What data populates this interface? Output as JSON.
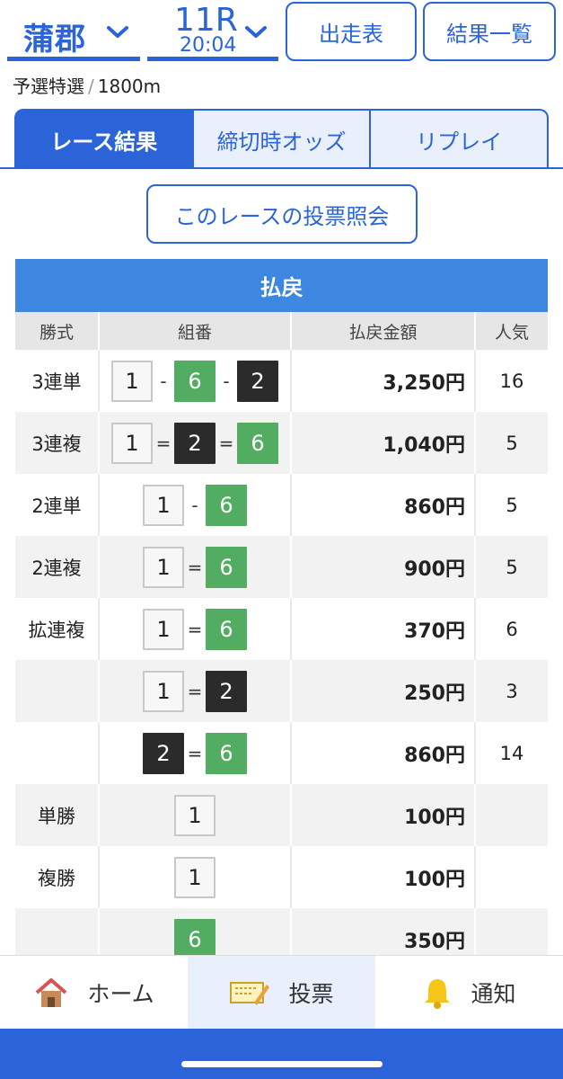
{
  "header": {
    "venue": "蒲郡",
    "race_number": "11R",
    "race_time": "20:04",
    "btn_entry": "出走表",
    "btn_results": "結果一覧"
  },
  "subtitle": {
    "race_type": "予選特選",
    "separator": "/",
    "distance": "1800m"
  },
  "tabs": [
    {
      "label": "レース結果",
      "active": true
    },
    {
      "label": "締切時オッズ",
      "active": false
    },
    {
      "label": "リプレイ",
      "active": false
    }
  ],
  "inquiry_button": "このレースの投票照会",
  "payout": {
    "title": "払戻",
    "headers": [
      "勝式",
      "組番",
      "払戻金額",
      "人気"
    ],
    "rows": [
      {
        "type": "3連単",
        "combo": [
          {
            "n": "1",
            "c": "white"
          },
          {
            "op": "-"
          },
          {
            "n": "6",
            "c": "green"
          },
          {
            "op": "-"
          },
          {
            "n": "2",
            "c": "black"
          }
        ],
        "amount": "3,250円",
        "pop": "16"
      },
      {
        "type": "3連複",
        "combo": [
          {
            "n": "1",
            "c": "white"
          },
          {
            "op": "="
          },
          {
            "n": "2",
            "c": "black"
          },
          {
            "op": "="
          },
          {
            "n": "6",
            "c": "green"
          }
        ],
        "amount": "1,040円",
        "pop": "5"
      },
      {
        "type": "2連単",
        "combo": [
          {
            "n": "1",
            "c": "white"
          },
          {
            "op": "-"
          },
          {
            "n": "6",
            "c": "green"
          }
        ],
        "amount": "860円",
        "pop": "5"
      },
      {
        "type": "2連複",
        "combo": [
          {
            "n": "1",
            "c": "white"
          },
          {
            "op": "="
          },
          {
            "n": "6",
            "c": "green"
          }
        ],
        "amount": "900円",
        "pop": "5"
      },
      {
        "type": "拡連複",
        "combo": [
          {
            "n": "1",
            "c": "white"
          },
          {
            "op": "="
          },
          {
            "n": "6",
            "c": "green"
          }
        ],
        "amount": "370円",
        "pop": "6"
      },
      {
        "type": "",
        "combo": [
          {
            "n": "1",
            "c": "white"
          },
          {
            "op": "="
          },
          {
            "n": "2",
            "c": "black"
          }
        ],
        "amount": "250円",
        "pop": "3"
      },
      {
        "type": "",
        "combo": [
          {
            "n": "2",
            "c": "black"
          },
          {
            "op": "="
          },
          {
            "n": "6",
            "c": "green"
          }
        ],
        "amount": "860円",
        "pop": "14"
      },
      {
        "type": "単勝",
        "combo": [
          {
            "n": "1",
            "c": "white"
          }
        ],
        "amount": "100円",
        "pop": ""
      },
      {
        "type": "複勝",
        "combo": [
          {
            "n": "1",
            "c": "white"
          }
        ],
        "amount": "100円",
        "pop": ""
      },
      {
        "type": "",
        "combo": [
          {
            "n": "6",
            "c": "green"
          }
        ],
        "amount": "350円",
        "pop": ""
      }
    ]
  },
  "nav": [
    {
      "label": "ホーム",
      "icon": "house-icon",
      "active": false
    },
    {
      "label": "投票",
      "icon": "ticket-pen-icon",
      "active": true
    },
    {
      "label": "通知",
      "icon": "bell-icon",
      "active": false
    }
  ],
  "colors": {
    "accent": "#2a64d8",
    "table_header": "#3d87e0",
    "green": "#52ad62",
    "black": "#2b2b2b"
  }
}
